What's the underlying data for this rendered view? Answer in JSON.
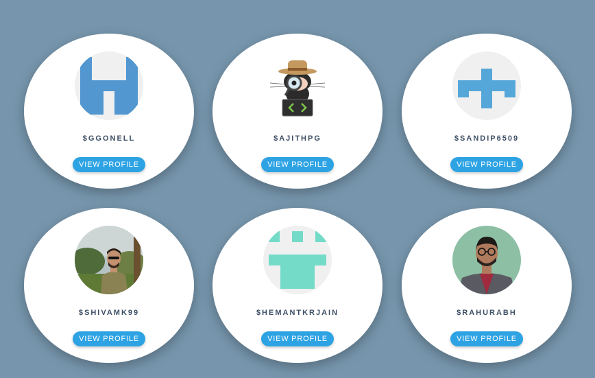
{
  "profiles": [
    {
      "username": "$GGONELL",
      "button_label": "VIEW PROFILE",
      "avatar": "identicon-blue-h",
      "accent": "#5297d0"
    },
    {
      "username": "$AJITHPG",
      "button_label": "VIEW PROFILE",
      "avatar": "octocat-detective",
      "accent": "#2b2b2b"
    },
    {
      "username": "$SANDIP6509",
      "button_label": "VIEW PROFILE",
      "avatar": "identicon-blue-cross",
      "accent": "#56a7d9"
    },
    {
      "username": "$SHIVAMK99",
      "button_label": "VIEW PROFILE",
      "avatar": "photo-outdoor-man",
      "accent": "#8a9a55"
    },
    {
      "username": "$HEMANTKRJAIN",
      "button_label": "VIEW PROFILE",
      "avatar": "identicon-mint",
      "accent": "#74dbc8"
    },
    {
      "username": "$RAHURABH",
      "button_label": "VIEW PROFILE",
      "avatar": "photo-man-glasses",
      "accent": "#8dbfa4"
    }
  ],
  "colors": {
    "background": "#7796ad",
    "card": "#ffffff",
    "button": "#2ea3e3",
    "username_text": "#3d4f66"
  }
}
